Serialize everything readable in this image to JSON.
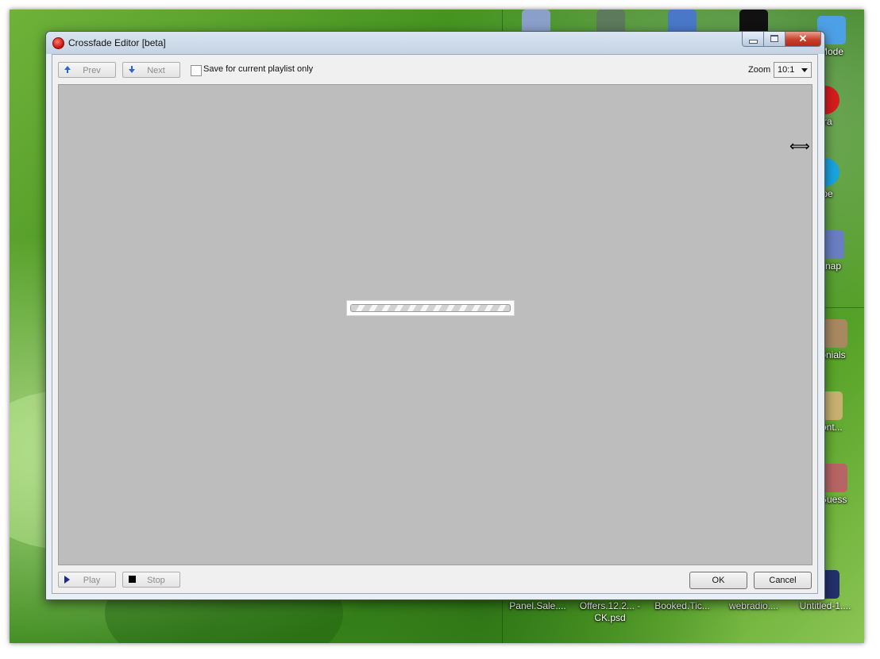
{
  "window": {
    "title": "Crossfade Editor [beta]",
    "close_glyph": "✕"
  },
  "toolbar": {
    "prev_label": "Prev",
    "next_label": "Next",
    "save_label": "Save for current playlist only",
    "save_checked": false,
    "zoom_label": "Zoom",
    "zoom_value": "10:1"
  },
  "progress": {
    "state": "indeterminate"
  },
  "cursor": {
    "glyph": "⟺"
  },
  "footer": {
    "play_label": "Play",
    "stop_label": "Stop",
    "ok_label": "OK",
    "cancel_label": "Cancel"
  },
  "desktop": {
    "right_icons": [
      "Mode",
      "era",
      "ype",
      "Snap",
      "onials",
      "Cont...",
      "Guess"
    ],
    "bottom_icons": [
      "Panel.Sale....",
      "Offers.12.2... - CK.psd",
      "Booked.Tic...",
      "webradio....",
      "Untitled-1...."
    ]
  },
  "colors": {
    "panel_bg": "#bdbdbd",
    "window_bg": "#e9eef5",
    "accent_blue": "#2a65d6",
    "close_red": "#c9402a"
  }
}
